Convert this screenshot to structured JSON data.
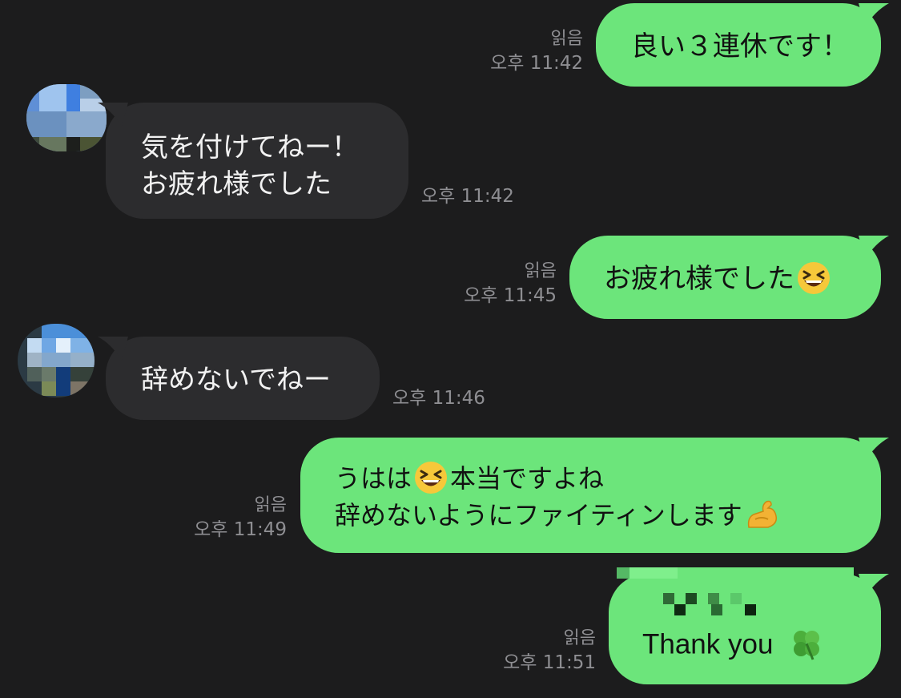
{
  "messages": [
    {
      "dir": "out",
      "text_lines": [
        "良い３連休です！"
      ],
      "read": "읽음",
      "time": "오후 11:42"
    },
    {
      "dir": "in",
      "text_lines": [
        "気を付けてねー！",
        "お疲れ様でした"
      ],
      "time": "오후 11:42"
    },
    {
      "dir": "out",
      "text_lines": [
        "お疲れ様でした"
      ],
      "emoji_after": "grinning-squinting-face-icon",
      "read": "읽음",
      "time": "오후 11:45"
    },
    {
      "dir": "in",
      "text_lines": [
        "辞めないでねー"
      ],
      "time": "오후 11:46"
    },
    {
      "dir": "out",
      "text_lines": [
        "うはは",
        "本当ですよね",
        "辞めないようにファイティンします"
      ],
      "read": "읽음",
      "time": "오후 11:49"
    },
    {
      "dir": "out",
      "text_lines": [
        "Thank you"
      ],
      "emoji_after": "four-leaf-clover-icon",
      "read": "읽음",
      "time": "오후 11:51"
    }
  ],
  "colors": {
    "background": "#1c1c1d",
    "outgoing_bubble": "#6ce57b",
    "incoming_bubble": "#2c2c2e",
    "meta_text": "#8e8e92"
  }
}
